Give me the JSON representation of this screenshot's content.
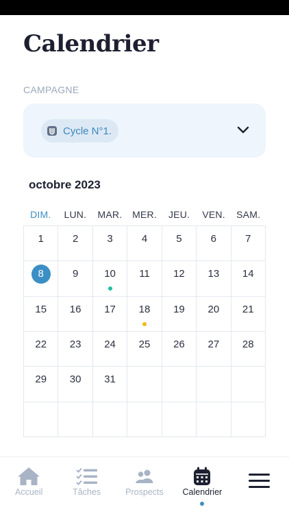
{
  "page": {
    "title": "Calendrier"
  },
  "campaign": {
    "section_label": "CAMPAGNE",
    "selected": "Cycle N°1.",
    "icon": "campaign-badge-icon"
  },
  "calendar": {
    "month_title": "octobre 2023",
    "weekdays": [
      "DIM.",
      "LUN.",
      "MAR.",
      "MER.",
      "JEU.",
      "VEN.",
      "SAM."
    ],
    "active_weekday": "DIM.",
    "today": "8",
    "weeks": [
      [
        "1",
        "2",
        "3",
        "4",
        "5",
        "6",
        "7"
      ],
      [
        "8",
        "9",
        "10",
        "11",
        "12",
        "13",
        "14"
      ],
      [
        "15",
        "16",
        "17",
        "18",
        "19",
        "20",
        "21"
      ],
      [
        "22",
        "23",
        "24",
        "25",
        "26",
        "27",
        "28"
      ],
      [
        "29",
        "30",
        "31",
        "",
        "",
        "",
        ""
      ],
      [
        "",
        "",
        "",
        "",
        "",
        "",
        ""
      ]
    ],
    "event_markers": [
      {
        "day": "10",
        "color": "#1fbf9f"
      },
      {
        "day": "18",
        "color": "#f2b81c"
      }
    ]
  },
  "nav": {
    "items": [
      {
        "label": "Accueil",
        "icon": "home-icon"
      },
      {
        "label": "Tâches",
        "icon": "task-list-icon"
      },
      {
        "label": "Prospects",
        "icon": "users-icon"
      },
      {
        "label": "Calendrier",
        "icon": "calendar-icon",
        "active": true
      }
    ],
    "menu_icon": "hamburger-menu-icon"
  },
  "colors": {
    "accent": "#3b8fc4",
    "card_bg": "#eef5fc",
    "nav_inactive": "#a8b4c6",
    "text_dark": "#1c2030"
  }
}
